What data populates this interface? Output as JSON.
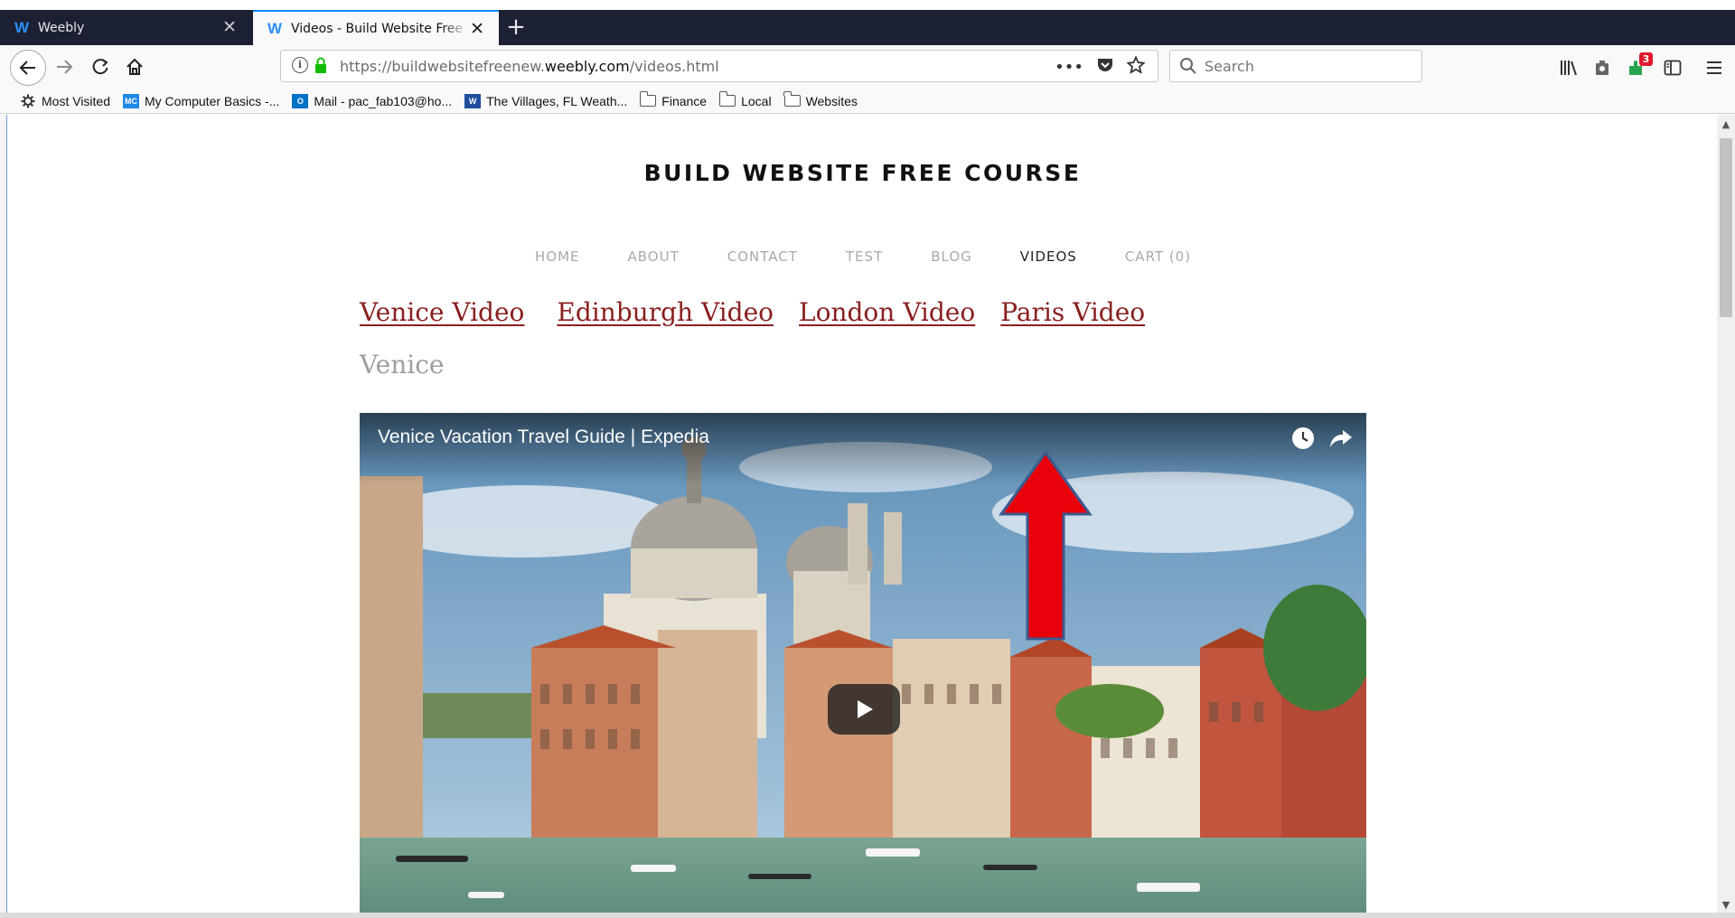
{
  "browser": {
    "tabs": [
      {
        "label": "Weebly",
        "favicon": "weebly-icon"
      },
      {
        "label": "Videos - Build Website Free Course",
        "favicon": "weebly-icon"
      }
    ],
    "new_tab_label": "+",
    "url": {
      "prefix": "https://buildwebsitefreenew.",
      "domain": "weebly.com",
      "path": "/videos.html"
    },
    "page_actions_more": "•••",
    "search": {
      "placeholder": "Search"
    },
    "addon_badge_count": "3",
    "bookmarks": [
      {
        "label": "Most Visited",
        "icon": "gear-icon"
      },
      {
        "label": "My Computer Basics -...",
        "icon": "site-favicon"
      },
      {
        "label": "Mail - pac_fab103@ho...",
        "icon": "outlook-icon"
      },
      {
        "label": "The Villages, FL Weath...",
        "icon": "weather-icon"
      },
      {
        "label": "Finance",
        "icon": "folder-icon"
      },
      {
        "label": "Local",
        "icon": "folder-icon"
      },
      {
        "label": "Websites",
        "icon": "folder-icon"
      }
    ],
    "accent_color": "#0a84ff"
  },
  "site": {
    "title": "BUILD WEBSITE FREE COURSE",
    "nav": [
      {
        "label": "HOME",
        "active": false
      },
      {
        "label": "ABOUT",
        "active": false
      },
      {
        "label": "CONTACT",
        "active": false
      },
      {
        "label": "TEST",
        "active": false
      },
      {
        "label": "BLOG",
        "active": false
      },
      {
        "label": "VIDEOS",
        "active": true
      },
      {
        "label": "CART (0)",
        "active": false
      }
    ],
    "video_links": [
      "Venice Video",
      "Edinburgh Video",
      "London Video",
      "Paris Video"
    ],
    "link_color": "#8a1f1f",
    "section_heading": "Venice",
    "video": {
      "title": "Venice Vacation Travel Guide | Expedia"
    },
    "annotation_arrow_color": "#e8000b"
  }
}
